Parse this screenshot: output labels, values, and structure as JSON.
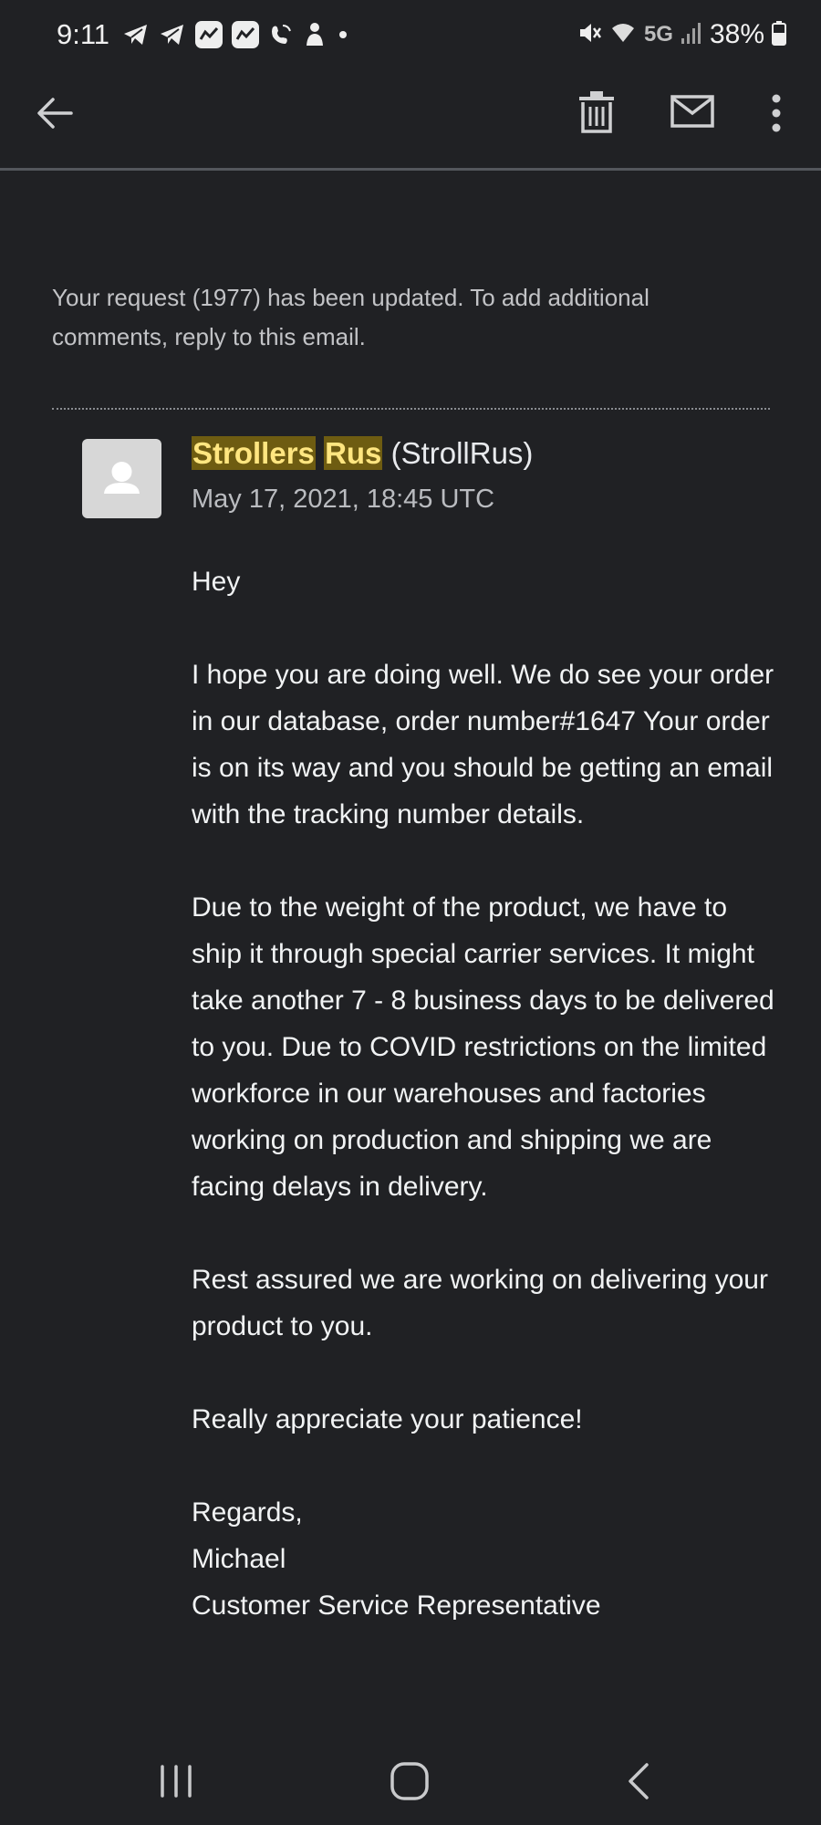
{
  "status_bar": {
    "time": "9:11",
    "network": "5G",
    "battery": "38%"
  },
  "app_bar": {
    "icons": [
      "back-arrow-icon",
      "delete-icon",
      "mail-icon",
      "more-vert-icon"
    ]
  },
  "email": {
    "intro": "Your request (1977) has been updated. To add additional comments, reply to this email.",
    "sender_first": "Strollers",
    "sender_last": "Rus",
    "sender_handle": "(StrollRus)",
    "date": "May 17, 2021, 18:45 UTC",
    "highlight_color": "#6e5c11",
    "greeting": "Hey",
    "paragraph_1": "I hope you are doing well. We do see your order in our database, order number#1647 Your order is on its way and you should be getting an email with the tracking number details.",
    "paragraph_2": "Due to the weight of the product, we have to ship it through special carrier services. It might take another 7 - 8 business days to be delivered to you. Due to COVID restrictions on the limited workforce in our warehouses and factories working on production and shipping we are facing delays in delivery.",
    "paragraph_3": "Rest assured we are working on delivering your product to you.",
    "paragraph_4": "Really appreciate your patience!",
    "closing": "Regards,",
    "signature_name": "Michael",
    "signature_title": "Customer Service Representative"
  },
  "nav_bar": {
    "icons": [
      "recent-apps-icon",
      "home-icon",
      "back-icon"
    ]
  }
}
